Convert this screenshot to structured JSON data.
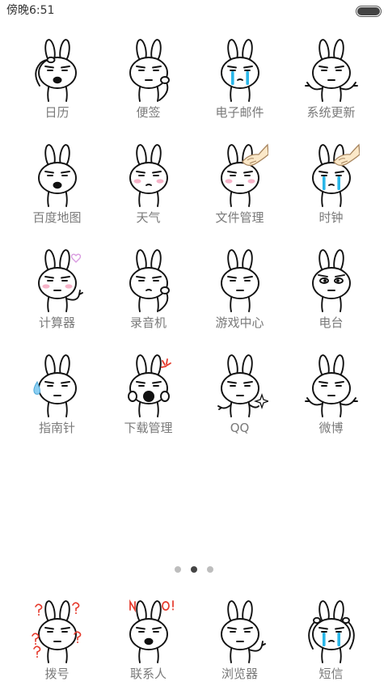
{
  "status_bar": {
    "time": "傍晚6:51",
    "battery_level": 1.0
  },
  "home_grid": [
    {
      "label": "日历",
      "icon": "rabbit-shocked-icon"
    },
    {
      "label": "便签",
      "icon": "rabbit-thinking-icon"
    },
    {
      "label": "电子邮件",
      "icon": "rabbit-crying-icon"
    },
    {
      "label": "系统更新",
      "icon": "rabbit-dismissive-icon"
    },
    {
      "label": "百度地图",
      "icon": "rabbit-gasp-icon"
    },
    {
      "label": "天气",
      "icon": "rabbit-blushing-icon"
    },
    {
      "label": "文件管理",
      "icon": "rabbit-petted-icon"
    },
    {
      "label": "时钟",
      "icon": "rabbit-sobbing-icon"
    },
    {
      "label": "计算器",
      "icon": "rabbit-love-icon"
    },
    {
      "label": "录音机",
      "icon": "rabbit-facepalm-icon"
    },
    {
      "label": "游戏中心",
      "icon": "rabbit-plain-icon"
    },
    {
      "label": "电台",
      "icon": "rabbit-staring-icon"
    },
    {
      "label": "指南针",
      "icon": "rabbit-sweating-icon"
    },
    {
      "label": "下载管理",
      "icon": "rabbit-screaming-icon"
    },
    {
      "label": "QQ",
      "icon": "rabbit-pointing-icon"
    },
    {
      "label": "微博",
      "icon": "rabbit-shrugging-icon"
    }
  ],
  "pager": {
    "pages": 3,
    "active_page": 2
  },
  "dock": [
    {
      "label": "拨号",
      "icon": "rabbit-confused-icon"
    },
    {
      "label": "联系人",
      "icon": "rabbit-yelling-icon"
    },
    {
      "label": "浏览器",
      "icon": "rabbit-waving-icon"
    },
    {
      "label": "短信",
      "icon": "rabbit-weeping-icon"
    }
  ],
  "colors": {
    "label": "#7a7a7a",
    "active_dot": "#444444",
    "inactive_dot": "#bdbdbd",
    "tears": "#29b6e8",
    "blush": "#f6b3c8",
    "accent_red": "#e5392b"
  }
}
